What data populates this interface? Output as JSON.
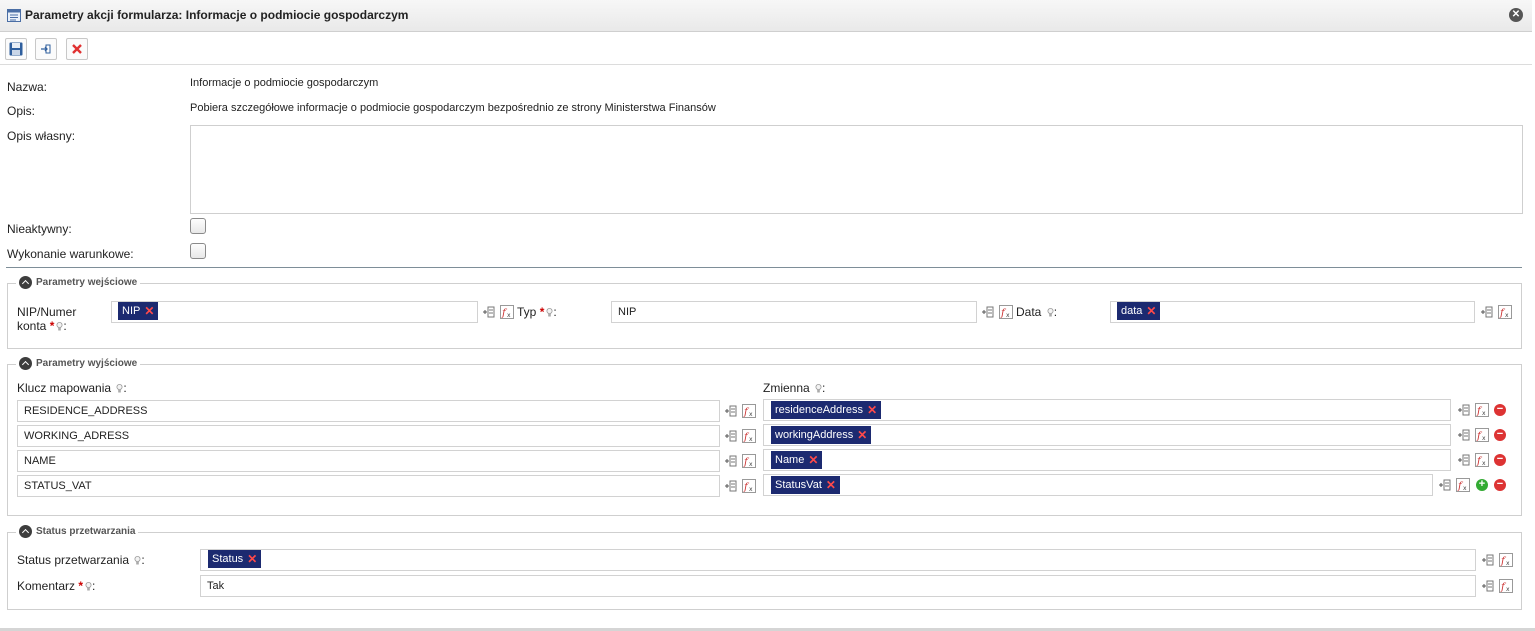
{
  "window": {
    "title": "Parametry akcji formularza: Informacje o podmiocie gospodarczym",
    "close_label": "✕"
  },
  "form": {
    "name_label": "Nazwa:",
    "name_value": "Informacje o podmiocie gospodarczym",
    "desc_label": "Opis:",
    "desc_value": "Pobiera szczegółowe informacje o podmiocie gospodarczym bezpośrednio ze strony Ministerstwa Finansów",
    "own_desc_label": "Opis własny:",
    "own_desc_value": "",
    "inactive_label": "Nieaktywny:",
    "conditional_label": "Wykonanie warunkowe:"
  },
  "inputs_section": {
    "title": "Parametry wejściowe",
    "nip_label_line1": "NIP/Numer",
    "nip_label_line2": "konta",
    "nip_tag": "NIP",
    "type_label": "Typ",
    "type_value": "NIP",
    "date_label": "Data",
    "date_tag": "data",
    "required_mark": "*",
    "colon": ":"
  },
  "outputs_section": {
    "title": "Parametry wyjściowe",
    "key_header": "Klucz mapowania",
    "var_header": "Zmienna",
    "rows": [
      {
        "key": "RESIDENCE_ADDRESS",
        "var": "residenceAddress"
      },
      {
        "key": "WORKING_ADRESS",
        "var": "workingAddress"
      },
      {
        "key": "NAME",
        "var": "Name"
      },
      {
        "key": "STATUS_VAT",
        "var": "StatusVat"
      }
    ]
  },
  "status_section": {
    "title": "Status przetwarzania",
    "status_label": "Status przetwarzania",
    "status_tag": "Status",
    "comment_label": "Komentarz",
    "comment_value": "Tak"
  },
  "tag_remove": "✕",
  "colors": {
    "tag_bg": "#1c2a70",
    "tag_x": "#ff4a4a",
    "required": "#cc0000",
    "separator": "#7e8e98"
  }
}
